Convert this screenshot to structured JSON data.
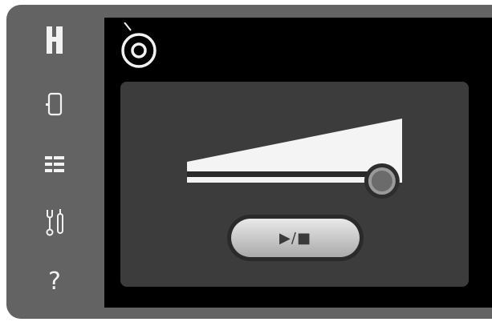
{
  "sidebar": {
    "items": [
      {
        "icon": "presser-foot-icon"
      },
      {
        "icon": "needle-plate-icon"
      },
      {
        "icon": "stitch-list-icon"
      },
      {
        "icon": "tools-icon"
      },
      {
        "icon": "help-icon",
        "label": "?"
      }
    ]
  },
  "header": {
    "icon": "bobbin-icon"
  },
  "speed": {
    "level": 0.92
  },
  "play_stop": {
    "label": "▶/■"
  },
  "colors": {
    "device": "#636363",
    "screen": "#000000",
    "panel": "#3c3c3c",
    "icon": "#f2f2f2",
    "slider_fill": "#f4f4f4",
    "knob": "#6b6b6b"
  }
}
